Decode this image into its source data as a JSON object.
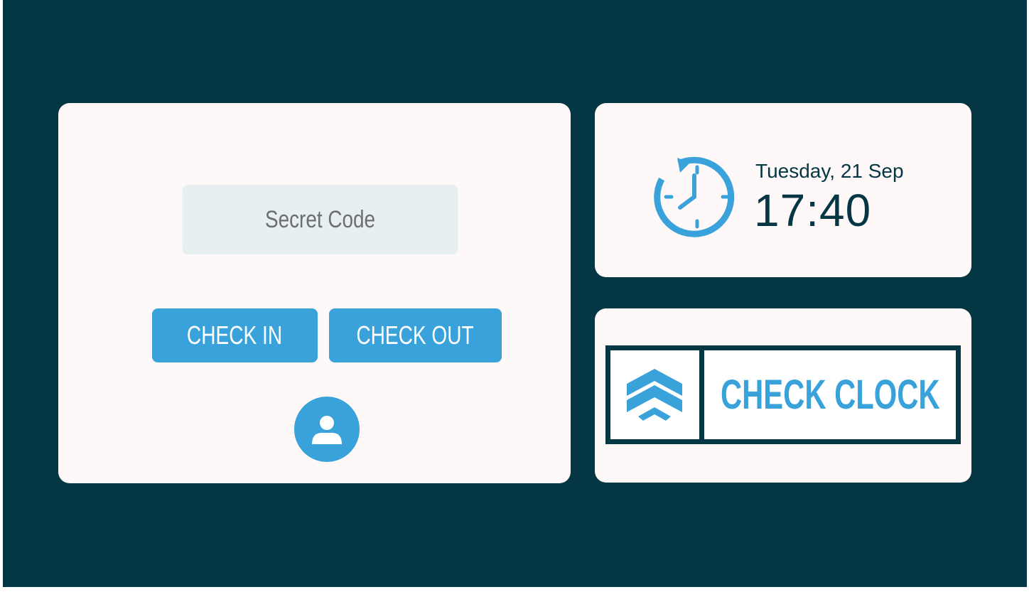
{
  "login": {
    "secret_code_placeholder": "Secret Code",
    "secret_code_value": "",
    "check_in_label": "CHECK IN",
    "check_out_label": "CHECK OUT",
    "profile_icon": "user-icon"
  },
  "clock": {
    "icon": "clock-refresh-icon",
    "date": "Tuesday, 21 Sep",
    "time": "17:40"
  },
  "brand": {
    "logo_icon": "chevron-up-stack-icon",
    "name": "CHECK CLOCK"
  },
  "colors": {
    "background": "#053643",
    "card": "#fef8f8",
    "accent": "#3aa2db",
    "input": "#e8eff1",
    "text_dark": "#053643",
    "placeholder": "#6b6f70"
  }
}
